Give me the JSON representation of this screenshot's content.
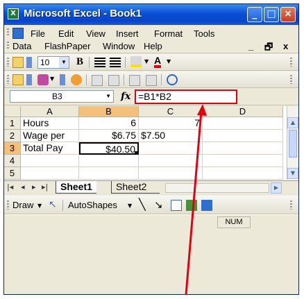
{
  "window": {
    "title": "Microsoft Excel - Book1",
    "app_icon": "excel-icon",
    "controls": [
      "minimize-icon",
      "maximize-icon",
      "close-icon"
    ]
  },
  "menu": {
    "row1": [
      "File",
      "Edit",
      "View",
      "Insert",
      "Format",
      "Tools"
    ],
    "row2": [
      "Data",
      "FlashPaper",
      "Window",
      "Help"
    ],
    "doc_minimize": "_",
    "doc_restore": "🗗",
    "doc_close": "x"
  },
  "format_toolbar": {
    "font_size": "10",
    "bold": "B"
  },
  "formula_bar": {
    "name_box": "B3",
    "fx": "fx",
    "formula": "=B1*B2"
  },
  "columns": [
    "A",
    "B",
    "C",
    "D"
  ],
  "selected_column": "B",
  "rows": [
    {
      "num": "1",
      "a": "Hours",
      "b": "6",
      "c": "7"
    },
    {
      "num": "2",
      "a": "Wage per",
      "b": "$6.75",
      "c": "$7.50"
    },
    {
      "num": "3",
      "a": "Total Pay",
      "b": "$40.50",
      "c": ""
    },
    {
      "num": "4",
      "a": "",
      "b": "",
      "c": ""
    },
    {
      "num": "5",
      "a": "",
      "b": "",
      "c": ""
    }
  ],
  "active_cell": "B3",
  "sheet_tabs": {
    "active": "Sheet1",
    "inactive": "Sheet2"
  },
  "drawing_toolbar": {
    "draw": "Draw",
    "autoshapes": "AutoShapes"
  },
  "status": {
    "num": "NUM"
  },
  "accent": {
    "title_blue": "#0a4fd6",
    "highlight": "#e3000f",
    "selected_header": "#f5c07a"
  }
}
